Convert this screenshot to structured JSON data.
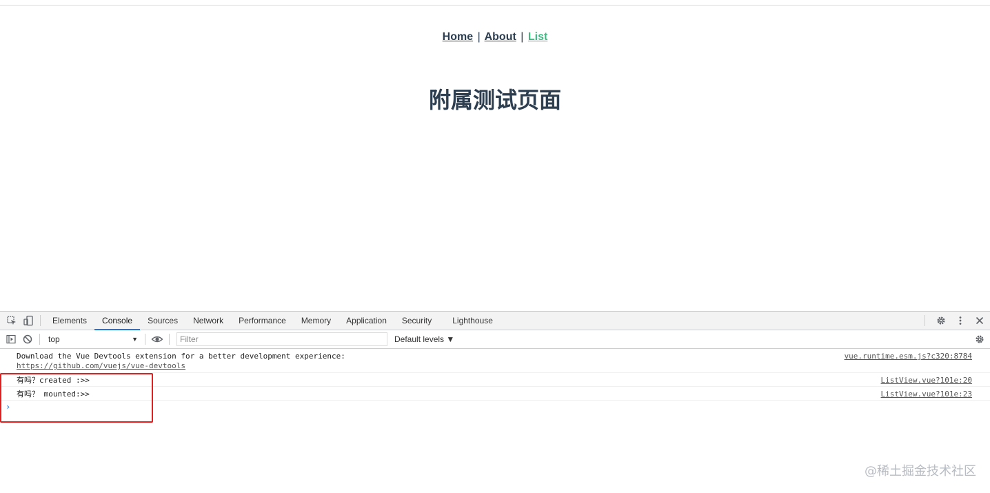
{
  "nav": {
    "home": "Home",
    "about": "About",
    "list": "List",
    "separator": "|"
  },
  "page": {
    "title": "附属测试页面"
  },
  "devtools": {
    "tabs": [
      "Elements",
      "Console",
      "Sources",
      "Network",
      "Performance",
      "Memory",
      "Application",
      "Security",
      "Lighthouse"
    ],
    "active_tab": "Console",
    "toolbar": {
      "context": "top",
      "filter_placeholder": "Filter",
      "levels": "Default levels ▼"
    },
    "console": {
      "messages": [
        {
          "text": "Download the Vue Devtools extension for a better development experience:",
          "link": "https://github.com/vuejs/vue-devtools",
          "source": "vue.runtime.esm.js?c320:8784"
        },
        {
          "text": "有吗？created :>>",
          "source": "ListView.vue?101e:20"
        },
        {
          "text": "有吗？ mounted:>>",
          "source": "ListView.vue?101e:23"
        }
      ],
      "prompt": "›"
    },
    "icons": {
      "inspect": "inspect-element-icon",
      "device": "device-toggle-icon",
      "settings": "gear-icon",
      "more": "kebab-menu-icon",
      "close": "close-icon",
      "sidebar": "sidebar-toggle-icon",
      "clear": "clear-console-icon",
      "eye": "live-expression-icon"
    },
    "accent_color": "#1a73e8"
  },
  "colors": {
    "link_active": "#42b983",
    "text": "#2c3e50",
    "highlight_box": "#e02020"
  },
  "watermark": "@稀土掘金技术社区"
}
